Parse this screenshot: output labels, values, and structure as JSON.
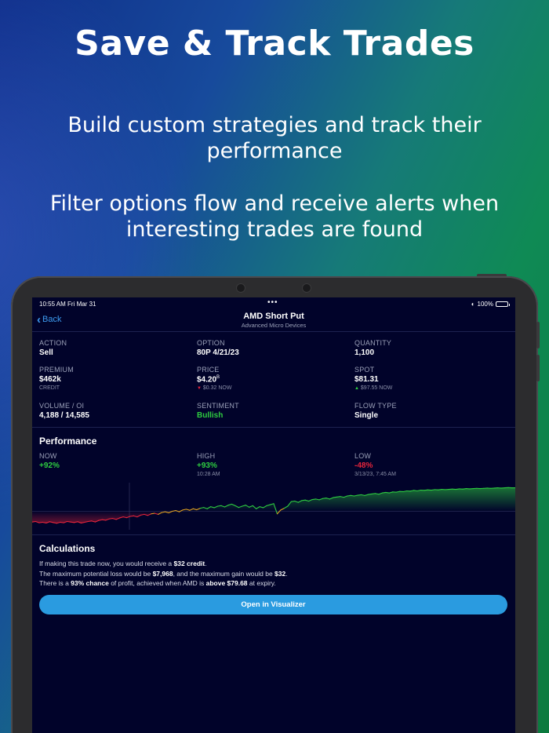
{
  "marketing": {
    "headline": "Save & Track Trades",
    "sub1": "Build custom strategies and track their performance",
    "sub2": "Filter options flow and receive alerts when interesting trades are found"
  },
  "status_bar": {
    "time": "10:55 AM  Fri Mar 31",
    "battery": "100%"
  },
  "nav": {
    "back_label": "Back",
    "title": "AMD Short Put",
    "subtitle": "Advanced Micro Devices"
  },
  "details": {
    "action": {
      "label": "ACTION",
      "value": "Sell"
    },
    "option": {
      "label": "OPTION",
      "value": "80P 4/21/23"
    },
    "quantity": {
      "label": "QUANTITY",
      "value": "1,100"
    },
    "premium": {
      "label": "PREMIUM",
      "value": "$462k",
      "note": "CREDIT"
    },
    "price": {
      "label": "PRICE",
      "value": "$4.20",
      "superscript": "B",
      "note": "$0.32 NOW"
    },
    "spot": {
      "label": "SPOT",
      "value": "$81.31",
      "note": "$97.55 NOW"
    },
    "volume_oi": {
      "label": "VOLUME / OI",
      "value": "4,188 / 14,585"
    },
    "sentiment": {
      "label": "SENTIMENT",
      "value": "Bullish"
    },
    "flow_type": {
      "label": "FLOW TYPE",
      "value": "Single"
    }
  },
  "performance": {
    "title": "Performance",
    "now": {
      "label": "NOW",
      "value": "+92%"
    },
    "high": {
      "label": "HIGH",
      "value": "+93%",
      "note": "10:28 AM"
    },
    "low": {
      "label": "LOW",
      "value": "-48%",
      "note": "3/13/23, 7:45 AM"
    }
  },
  "chart_data": {
    "type": "line",
    "title": "",
    "xlabel": "",
    "ylabel": "",
    "ylim": [
      -60,
      100
    ],
    "colors": {
      "positive": "#2ecc40",
      "negative": "#e5243b",
      "transition": "#e0a020"
    },
    "values": [
      -42,
      -40,
      -45,
      -43,
      -46,
      -41,
      -44,
      -47,
      -43,
      -45,
      -40,
      -42,
      -44,
      -41,
      -46,
      -43,
      -40,
      -38,
      -42,
      -36,
      -33,
      -35,
      -30,
      -28,
      -32,
      -26,
      -22,
      -25,
      -20,
      -18,
      -22,
      -15,
      -12,
      -16,
      -10,
      -8,
      -12,
      -5,
      -2,
      -6,
      0,
      3,
      -2,
      5,
      8,
      4,
      10,
      6,
      12,
      15,
      10,
      18,
      14,
      20,
      22,
      17,
      24,
      28,
      22,
      15,
      20,
      24,
      16,
      22,
      10,
      18,
      14,
      22,
      26,
      30,
      -10,
      5,
      12,
      20,
      38,
      40,
      35,
      42,
      44,
      40,
      46,
      48,
      45,
      50,
      52,
      48,
      54,
      56,
      58,
      55,
      60,
      62,
      60,
      63,
      65,
      62,
      66,
      68,
      70,
      67,
      72,
      74,
      72,
      76,
      75,
      78,
      77,
      80,
      79,
      82,
      80,
      83,
      82,
      84,
      83,
      85,
      84,
      86,
      85,
      86,
      87,
      86,
      88,
      87,
      89,
      88,
      89,
      90,
      89,
      90,
      91,
      90,
      91,
      92,
      91,
      92,
      93,
      92,
      92
    ]
  },
  "calculations": {
    "title": "Calculations",
    "line1_pre": "If making this trade now, you would receive a ",
    "line1_bold": "$32 credit",
    "line1_post": ".",
    "line2_pre": "The maximum potential loss would be ",
    "line2_bold1": "$7,968",
    "line2_mid": ", and the maximum gain would be ",
    "line2_bold2": "$32",
    "line2_post": ".",
    "line3_pre": "There is a ",
    "line3_bold1": "93% chance",
    "line3_mid": " of profit, achieved when AMD is ",
    "line3_bold2": "above $79.68",
    "line3_post": " at expiry.",
    "button_label": "Open in Visualizer"
  }
}
